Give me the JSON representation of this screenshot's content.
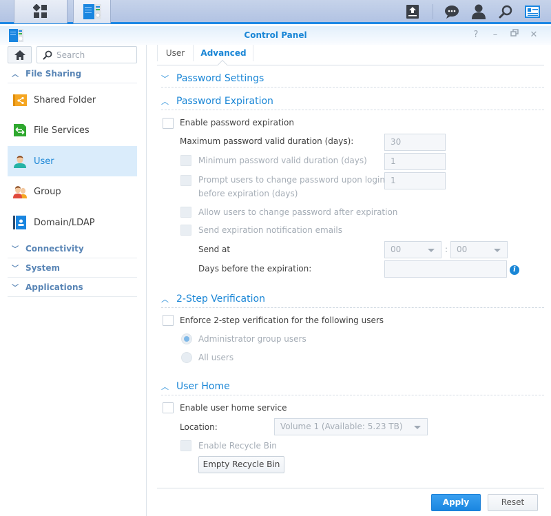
{
  "taskbar": {
    "left_buttons": [
      {
        "name": "main-menu",
        "icon": "grid-icon"
      },
      {
        "name": "control-panel",
        "icon": "control-panel-icon"
      }
    ],
    "right_icons": [
      "upload-icon",
      "chat-icon",
      "user-icon",
      "search-icon",
      "widgets-icon"
    ]
  },
  "window": {
    "title": "Control Panel",
    "controls": [
      "help-icon",
      "minimize-icon",
      "restore-icon",
      "close-icon"
    ]
  },
  "sidebar": {
    "search_placeholder": "Search",
    "categories": [
      {
        "label": "File Sharing",
        "expanded": true
      },
      {
        "label": "Connectivity",
        "expanded": false
      },
      {
        "label": "System",
        "expanded": false
      },
      {
        "label": "Applications",
        "expanded": false
      }
    ],
    "items": [
      {
        "label": "Shared Folder",
        "icon": "shared-folder-icon",
        "active": false
      },
      {
        "label": "File Services",
        "icon": "file-services-icon",
        "active": false
      },
      {
        "label": "User",
        "icon": "user-icon",
        "active": true
      },
      {
        "label": "Group",
        "icon": "group-icon",
        "active": false
      },
      {
        "label": "Domain/LDAP",
        "icon": "domain-ldap-icon",
        "active": false
      }
    ]
  },
  "tabs": [
    {
      "label": "User",
      "active": false
    },
    {
      "label": "Advanced",
      "active": true
    }
  ],
  "sections": {
    "password_settings": {
      "title": "Password Settings",
      "expanded": false
    },
    "password_expiration": {
      "title": "Password Expiration",
      "expanded": true,
      "enable_label": "Enable password expiration",
      "enable_checked": false,
      "max_label": "Maximum password valid duration (days):",
      "max_value": "30",
      "min_label": "Minimum password valid duration (days)",
      "min_value": "1",
      "prompt_label_line1": "Prompt users to change password upon login",
      "prompt_label_line2": "before expiration (days)",
      "prompt_value": "1",
      "allow_label": "Allow users to change password after expiration",
      "notify_label": "Send expiration notification emails",
      "send_at_label": "Send at",
      "send_at_hour": "00",
      "send_at_sep": ":",
      "send_at_minute": "00",
      "days_before_label": "Days before the expiration:",
      "days_before_value": ""
    },
    "two_step": {
      "title": "2-Step Verification",
      "expanded": true,
      "enforce_label": "Enforce 2-step verification for the following users",
      "enforce_checked": false,
      "options": [
        {
          "label": "Administrator group users",
          "selected": true
        },
        {
          "label": "All users",
          "selected": false
        }
      ]
    },
    "user_home": {
      "title": "User Home",
      "expanded": true,
      "enable_label": "Enable user home service",
      "enable_checked": false,
      "location_label": "Location:",
      "location_value": "Volume 1 (Available: 5.23 TB)",
      "recycle_label": "Enable Recycle Bin",
      "empty_recycle_label": "Empty Recycle Bin"
    }
  },
  "footer": {
    "apply_label": "Apply",
    "reset_label": "Reset"
  },
  "colors": {
    "accent": "#1a86d6",
    "active_bg": "#daecfb",
    "taskbar": "#b8c8e6"
  }
}
